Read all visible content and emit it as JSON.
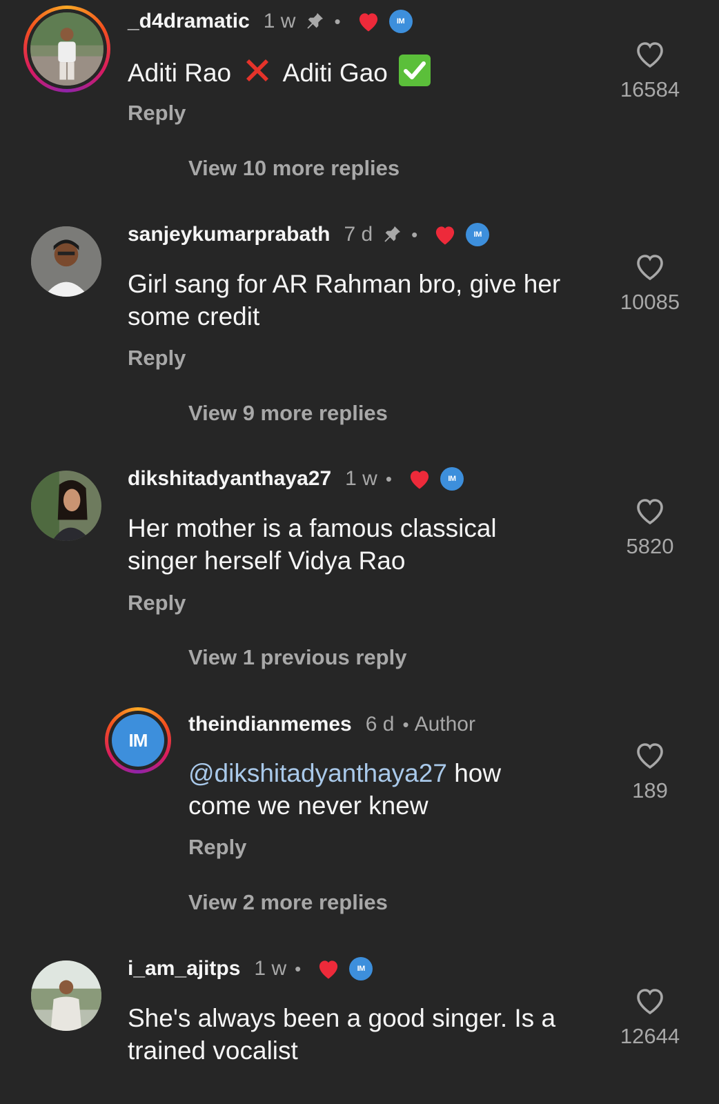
{
  "comments": [
    {
      "username": "_d4dramatic",
      "time": "1 w",
      "pinned": true,
      "author_liked": true,
      "badge": "IM",
      "text_before": "Aditi Rao",
      "text_middle": "Aditi Gao",
      "reply": "Reply",
      "likes": "16584",
      "view_replies": "View 10 more replies"
    },
    {
      "username": "sanjeykumarprabath",
      "time": "7 d",
      "pinned": true,
      "author_liked": true,
      "badge": "IM",
      "text_line1": "Girl sang for AR Rahman bro, give her",
      "text_line2": "some credit",
      "reply": "Reply",
      "likes": "10085",
      "view_replies": "View 9 more replies"
    },
    {
      "username": "dikshitadyanthaya27",
      "time": "1 w",
      "author_liked": true,
      "badge": "IM",
      "text_line1": "Her mother is a famous classical",
      "text_line2": "singer herself Vidya Rao",
      "reply": "Reply",
      "likes": "5820",
      "view_replies": "View 1 previous reply"
    },
    {
      "username": "theindianmemes",
      "time": "6 d",
      "author_label": "Author",
      "avatar_text": "IM",
      "mention": "@dikshitadyanthaya27",
      "text_after_mention": " how",
      "text_line2": "come we never knew",
      "reply": "Reply",
      "likes": "189",
      "view_replies": "View 2 more replies"
    },
    {
      "username": "i_am_ajitps",
      "time": "1 w",
      "author_liked": true,
      "badge": "IM",
      "text_line1": "She's always been a good singer. Is a",
      "text_line2": "trained vocalist",
      "likes": "12644"
    }
  ],
  "icons": {
    "like": "heart-outline-icon",
    "author_like": "red-heart-icon",
    "pinned": "pin-icon",
    "badge": "im-badge-icon"
  },
  "colors": {
    "background": "#262626",
    "username": "#f5f5f5",
    "secondary": "#a8a8a8",
    "mention": "#a9c9ea",
    "heart_red": "#ed2a3a",
    "badge_blue": "#3d8fdc"
  }
}
